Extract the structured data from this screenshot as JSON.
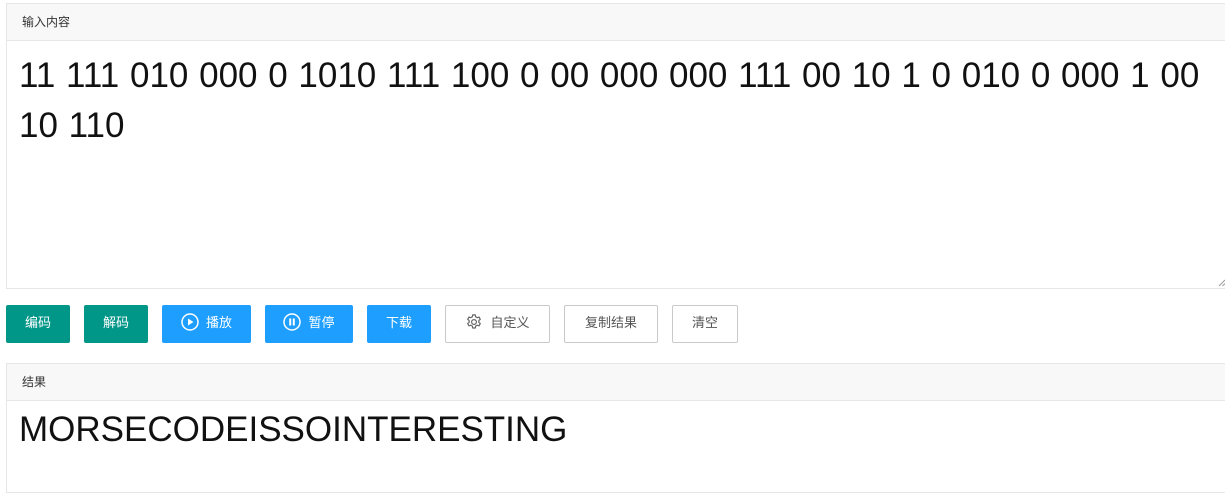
{
  "input_panel": {
    "header": "输入内容",
    "text": "11 111 010 000 0 1010 111 100 0 00 000 000 111 00 10 1 0 010 0 000 1 00 10 110"
  },
  "toolbar": {
    "encode_label": "编码",
    "decode_label": "解码",
    "play_label": "播放",
    "pause_label": "暂停",
    "download_label": "下载",
    "custom_label": "自定义",
    "copy_label": "复制结果",
    "clear_label": "清空"
  },
  "result_panel": {
    "header": "结果",
    "text": "MORSECODEISSOINTERESTING"
  },
  "colors": {
    "green": "#009688",
    "blue": "#1e9fff",
    "plain_border": "#c9c9c9"
  },
  "icons": {
    "play": "play-circle-icon",
    "pause": "pause-circle-icon",
    "custom": "gear-icon",
    "resize": "resize-grip-icon"
  }
}
